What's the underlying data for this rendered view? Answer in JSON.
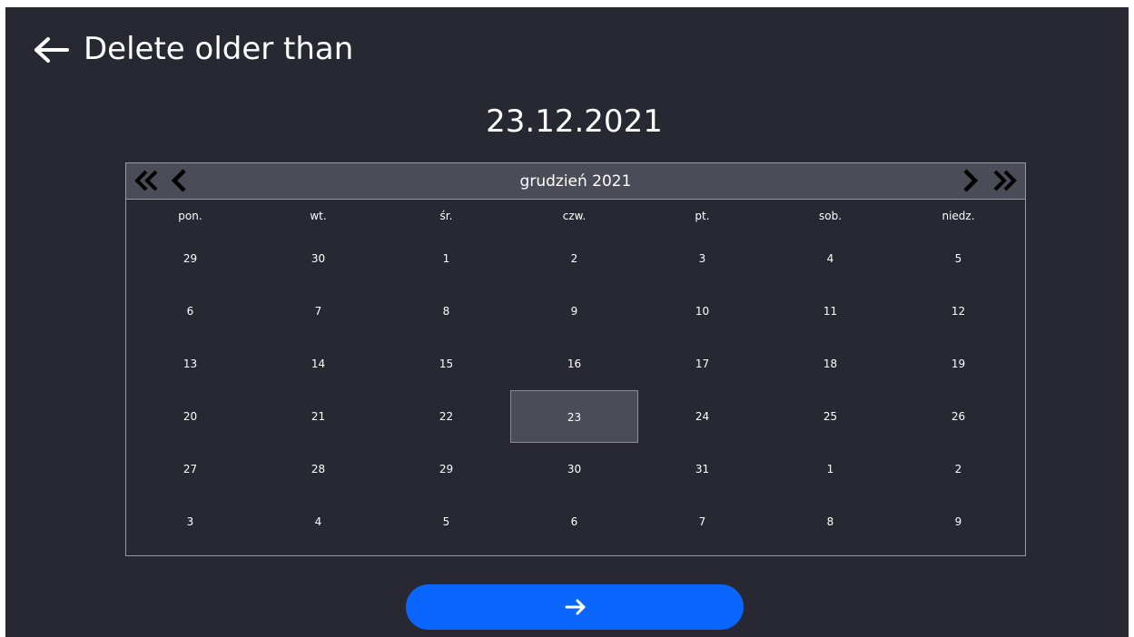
{
  "header": {
    "title": "Delete older than",
    "back_icon": "arrow-left-icon"
  },
  "selected_date": "23.12.2021",
  "calendar": {
    "month_label": "grudzień 2021",
    "nav_icons": [
      "double-chevron-left-icon",
      "chevron-left-icon",
      "chevron-right-icon",
      "double-chevron-right-icon"
    ],
    "weekdays": [
      "pon.",
      "wt.",
      "śr.",
      "czw.",
      "pt.",
      "sob.",
      "niedz."
    ],
    "weeks": [
      [
        "29",
        "30",
        "1",
        "2",
        "3",
        "4",
        "5"
      ],
      [
        "6",
        "7",
        "8",
        "9",
        "10",
        "11",
        "12"
      ],
      [
        "13",
        "14",
        "15",
        "16",
        "17",
        "18",
        "19"
      ],
      [
        "20",
        "21",
        "22",
        "23",
        "24",
        "25",
        "26"
      ],
      [
        "27",
        "28",
        "29",
        "30",
        "31",
        "1",
        "2"
      ],
      [
        "3",
        "4",
        "5",
        "6",
        "7",
        "8",
        "9"
      ]
    ],
    "selected_day": "23"
  },
  "confirm_button": {
    "icon": "arrow-right-icon"
  },
  "colors": {
    "background": "#282833",
    "header_bar": "#4a4c58",
    "accent": "#0a66ff",
    "text": "#ffffff"
  }
}
